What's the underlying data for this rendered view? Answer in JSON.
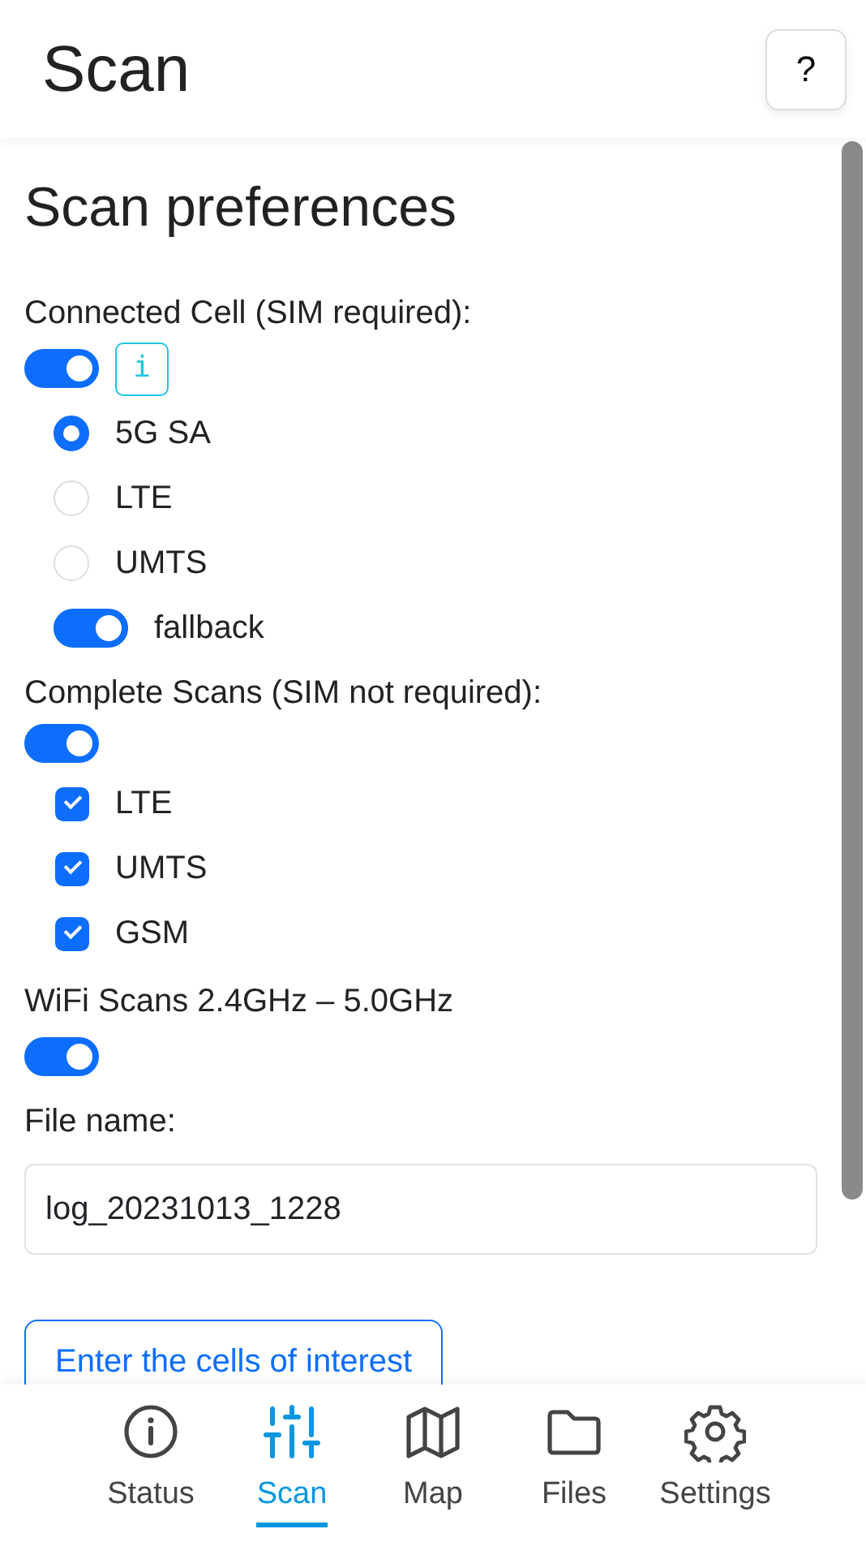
{
  "header": {
    "title": "Scan",
    "help_button": "?"
  },
  "heading": "Scan preferences",
  "connected_cell": {
    "label": "Connected Cell (SIM required):",
    "on": true,
    "info_button": "i",
    "radios": [
      {
        "label": "5G SA",
        "selected": true
      },
      {
        "label": "LTE",
        "selected": false
      },
      {
        "label": "UMTS",
        "selected": false
      }
    ],
    "fallback": {
      "label": "fallback",
      "on": true
    }
  },
  "complete_scans": {
    "label": "Complete Scans (SIM not required):",
    "on": true,
    "checkboxes": [
      {
        "label": "LTE",
        "checked": true
      },
      {
        "label": "UMTS",
        "checked": true
      },
      {
        "label": "GSM",
        "checked": true
      }
    ]
  },
  "wifi_scans": {
    "label": "WiFi Scans 2.4GHz – 5.0GHz",
    "on": true
  },
  "file_name": {
    "label": "File name:",
    "value": "log_20231013_1228"
  },
  "cells_button": "Enter the cells of interest",
  "nav": [
    {
      "label": "Status",
      "kind": "info",
      "selected": false
    },
    {
      "label": "Scan",
      "kind": "sliders",
      "selected": true
    },
    {
      "label": "Map",
      "kind": "map",
      "selected": false
    },
    {
      "label": "Files",
      "kind": "folder",
      "selected": false
    },
    {
      "label": "Settings",
      "kind": "gear",
      "selected": false
    }
  ]
}
